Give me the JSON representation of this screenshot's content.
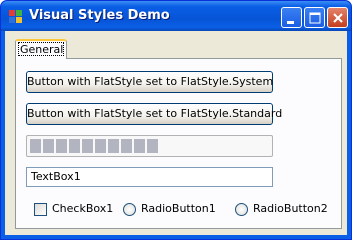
{
  "window": {
    "title": "Visual Styles Demo",
    "controls": [
      "minimize",
      "maximize",
      "close"
    ]
  },
  "tabs": [
    {
      "label": "General",
      "selected": true
    }
  ],
  "buttons": {
    "flat_system_label": "Button with FlatStyle set to FlatStyle.System",
    "flat_standard_label": "Button with FlatStyle set to FlatStyle.Standard"
  },
  "progress": {
    "value_fraction": 0.5,
    "segments_filled": 10
  },
  "textbox": {
    "value": "TextBox1"
  },
  "checkbox": {
    "label": "CheckBox1",
    "checked": false
  },
  "radios": [
    {
      "label": "RadioButton1",
      "checked": false
    },
    {
      "label": "RadioButton2",
      "checked": false
    }
  ],
  "colors": {
    "titlebar": "#0a5fe6",
    "close_button": "#c23f1f",
    "client_background": "#ece9d8",
    "tab_highlight": "#ffc83c",
    "progress_fill": "#b2b4bf"
  },
  "icons": {
    "app": "window-app-icon",
    "minimize": "minimize-icon",
    "maximize": "maximize-icon",
    "close": "close-icon"
  }
}
